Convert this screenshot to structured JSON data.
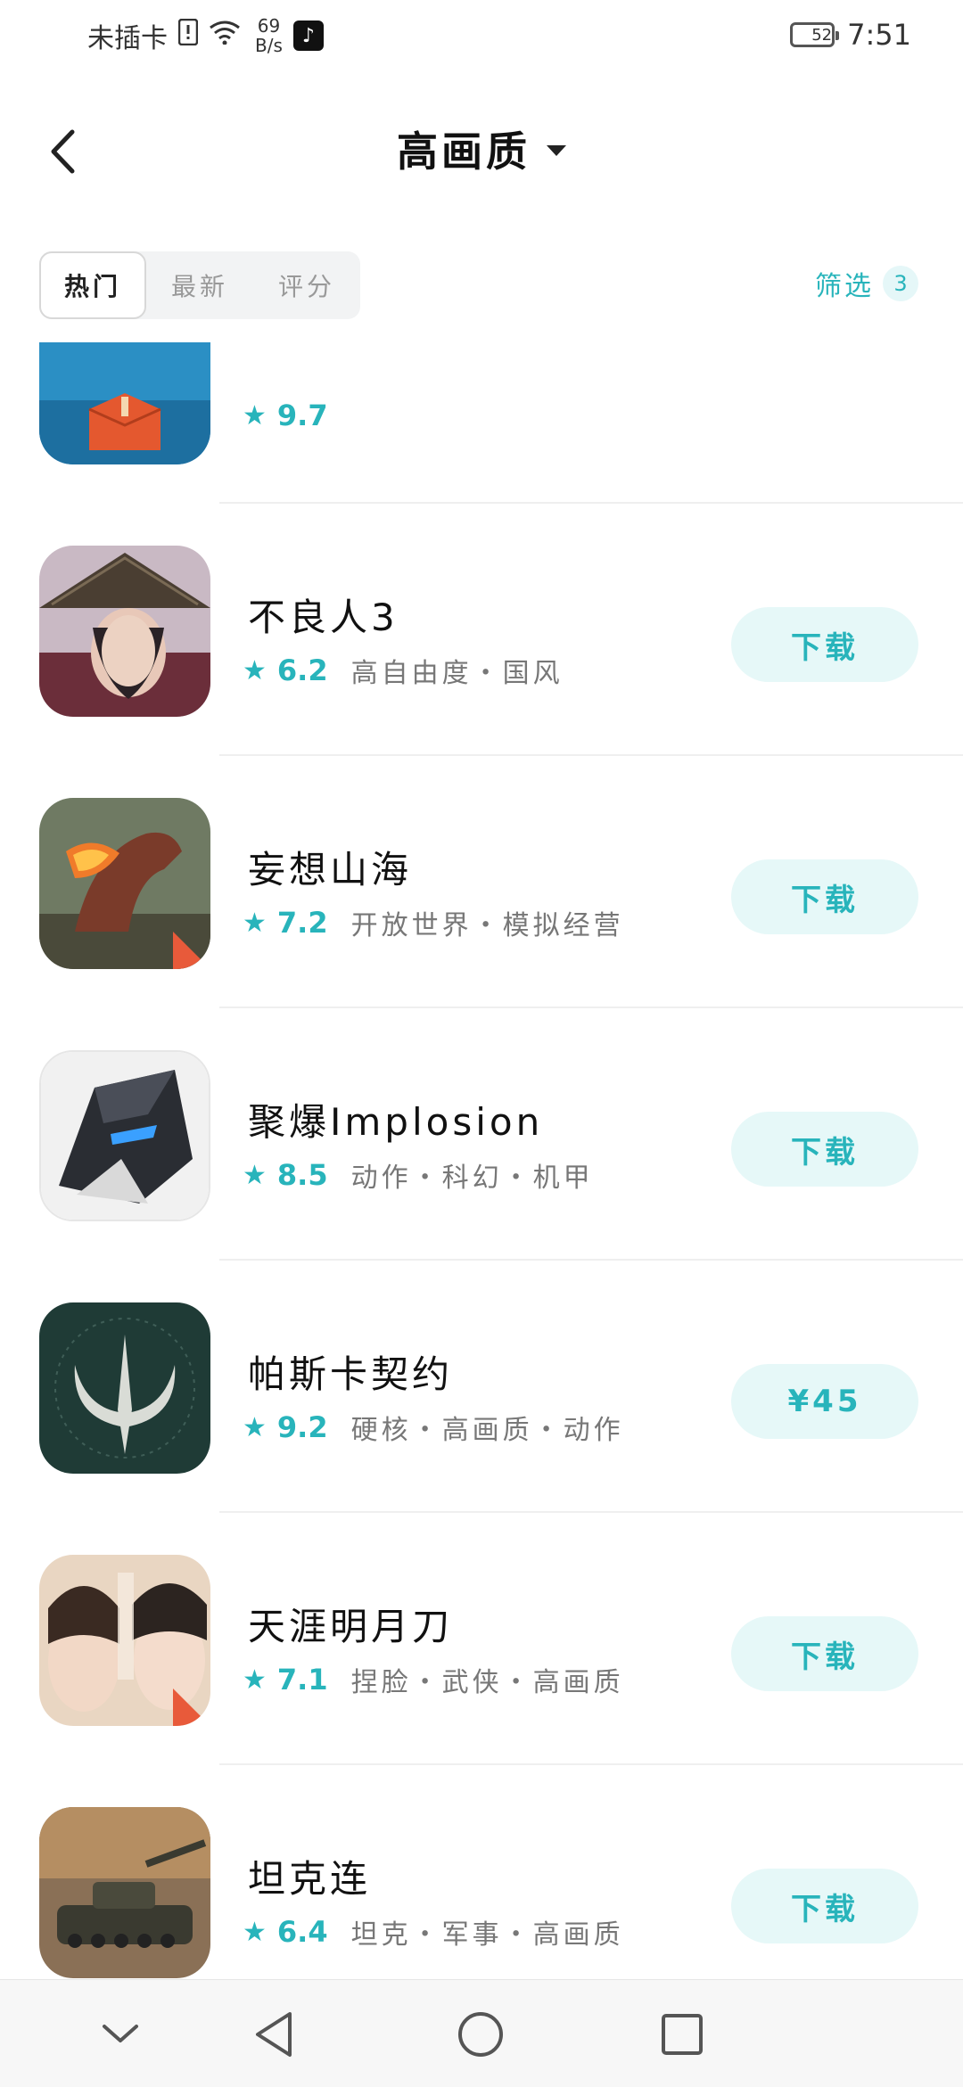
{
  "status_bar": {
    "carrier": "未插卡",
    "net_speed_value": "69",
    "net_speed_unit": "B/s",
    "battery": "52",
    "time": "7:51"
  },
  "header": {
    "title": "高画质"
  },
  "tabs": [
    "热门",
    "最新",
    "评分"
  ],
  "filter": {
    "label": "筛选",
    "count": "3"
  },
  "partial_row": {
    "rating": "9.7"
  },
  "games": [
    {
      "name": "不良人3",
      "rating": "6.2",
      "tags": "高自由度・国风",
      "action": "下载",
      "icon": "sword-hat-warrior-icon"
    },
    {
      "name": "妄想山海",
      "rating": "7.2",
      "tags": "开放世界・模拟经营",
      "action": "下载",
      "icon": "fire-dragon-icon"
    },
    {
      "name": "聚爆Implosion",
      "rating": "8.5",
      "tags": "动作・科幻・机甲",
      "action": "下载",
      "icon": "mecha-head-icon"
    },
    {
      "name": "帕斯卡契约",
      "rating": "9.2",
      "tags": "硬核・高画质・动作",
      "action": "¥45",
      "icon": "pascal-emblem-icon"
    },
    {
      "name": "天涯明月刀",
      "rating": "7.1",
      "tags": "捏脸・武侠・高画质",
      "action": "下载",
      "icon": "couple-portrait-icon"
    },
    {
      "name": "坦克连",
      "rating": "6.4",
      "tags": "坦克・军事・高画质",
      "action": "下载",
      "icon": "tank-icon"
    }
  ],
  "colors": {
    "accent": "#28b4bb",
    "button_bg": "#e6f8f8"
  }
}
